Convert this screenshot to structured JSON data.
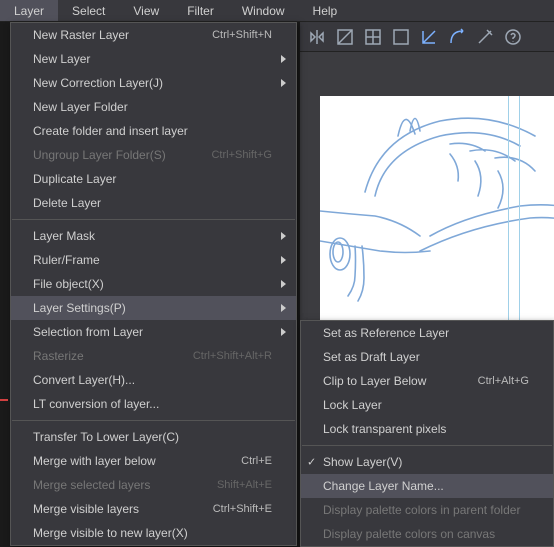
{
  "menubar": [
    "Layer",
    "Select",
    "View",
    "Filter",
    "Window",
    "Help"
  ],
  "menubar_active_index": 0,
  "layer_menu": [
    {
      "label": "New Raster Layer",
      "shortcut": "Ctrl+Shift+N"
    },
    {
      "label": "New Layer",
      "sub": true
    },
    {
      "label": "New Correction Layer(J)",
      "sub": true
    },
    {
      "label": "New Layer Folder"
    },
    {
      "label": "Create folder and insert layer"
    },
    {
      "label": "Ungroup Layer Folder(S)",
      "shortcut": "Ctrl+Shift+G",
      "disabled": true
    },
    {
      "label": "Duplicate Layer"
    },
    {
      "label": "Delete Layer"
    },
    {
      "sep": true
    },
    {
      "label": "Layer Mask",
      "sub": true
    },
    {
      "label": "Ruler/Frame",
      "sub": true
    },
    {
      "label": "File object(X)",
      "sub": true
    },
    {
      "label": "Layer Settings(P)",
      "sub": true,
      "highlighted": true
    },
    {
      "label": "Selection from Layer",
      "sub": true
    },
    {
      "label": "Rasterize",
      "shortcut": "Ctrl+Shift+Alt+R",
      "disabled": true
    },
    {
      "label": "Convert Layer(H)..."
    },
    {
      "label": "LT conversion of layer..."
    },
    {
      "sep": true
    },
    {
      "label": "Transfer To Lower Layer(C)"
    },
    {
      "label": "Merge with layer below",
      "shortcut": "Ctrl+E"
    },
    {
      "label": "Merge selected layers",
      "shortcut": "Shift+Alt+E",
      "disabled": true
    },
    {
      "label": "Merge visible layers",
      "shortcut": "Ctrl+Shift+E"
    },
    {
      "label": "Merge visible to new layer(X)"
    }
  ],
  "submenu": [
    {
      "label": "Set as Reference Layer"
    },
    {
      "label": "Set as Draft Layer"
    },
    {
      "label": "Clip to Layer Below",
      "shortcut": "Ctrl+Alt+G"
    },
    {
      "label": "Lock Layer"
    },
    {
      "label": "Lock transparent pixels"
    },
    {
      "sep": true
    },
    {
      "label": "Show Layer(V)",
      "checked": true
    },
    {
      "label": "Change Layer Name...",
      "highlighted": true
    },
    {
      "label": "Display palette colors in parent folder",
      "disabled": true
    },
    {
      "label": "Display palette colors on canvas",
      "disabled": true
    }
  ]
}
